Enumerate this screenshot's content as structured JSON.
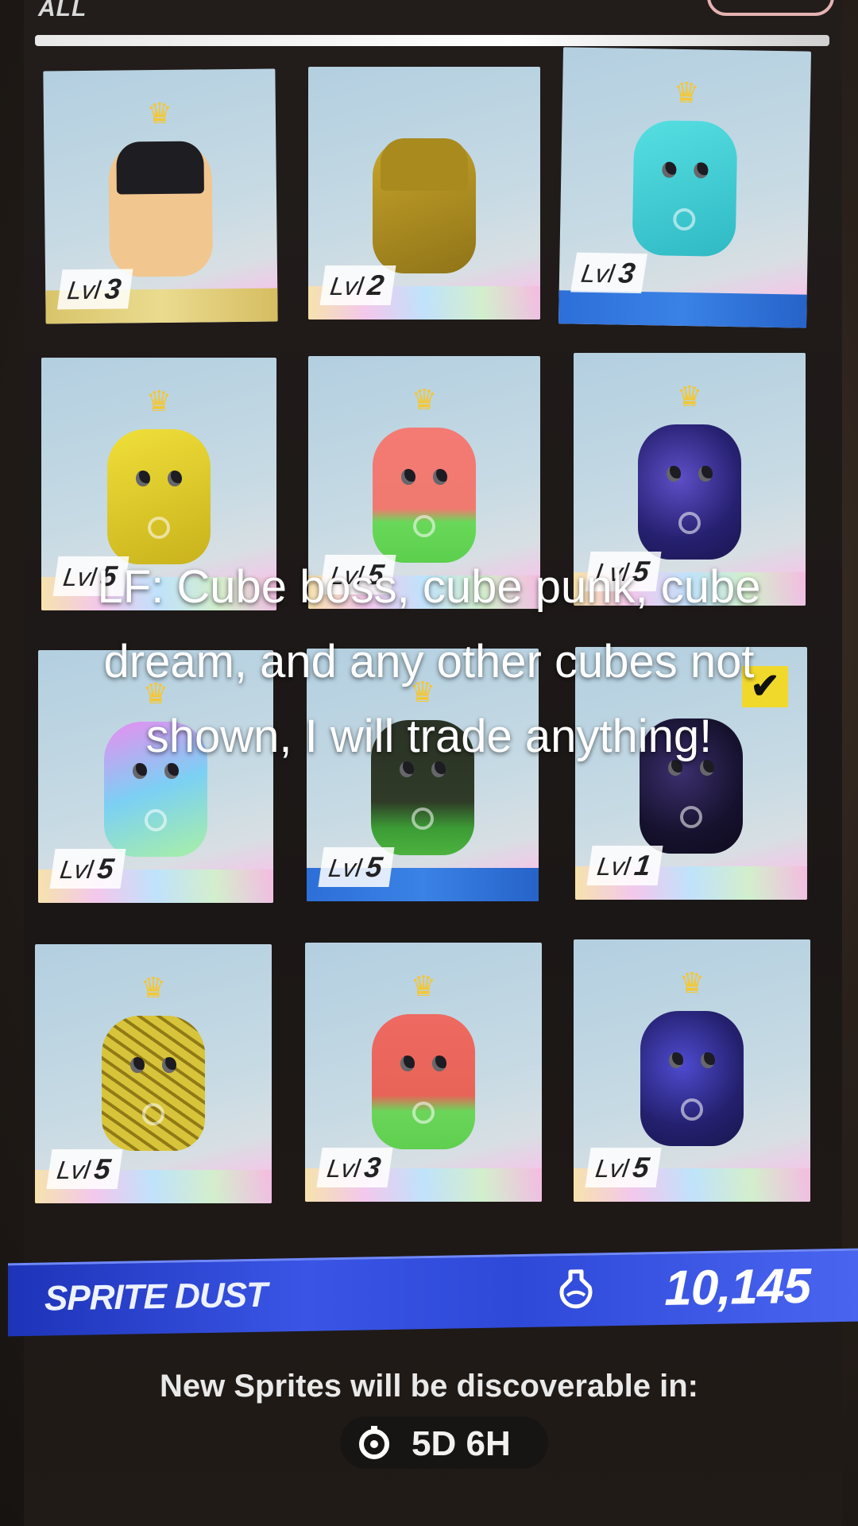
{
  "header": {
    "tab_label": "ALL"
  },
  "cards": [
    {
      "level_prefix": "Lvl",
      "level": "3",
      "sprite": "batman-cube-sprite"
    },
    {
      "level_prefix": "Lvl",
      "level": "2",
      "sprite": "gold-batman-cube-sprite"
    },
    {
      "level_prefix": "Lvl",
      "level": "3",
      "sprite": "teal-sprite"
    },
    {
      "level_prefix": "Lvl",
      "level": "5",
      "sprite": "yellow-sprite"
    },
    {
      "level_prefix": "Lvl",
      "level": "5",
      "sprite": "watermelon-sprite"
    },
    {
      "level_prefix": "Lvl",
      "level": "5",
      "sprite": "galaxy-sprite"
    },
    {
      "level_prefix": "Lvl",
      "level": "5",
      "sprite": "holographic-sprite"
    },
    {
      "level_prefix": "Lvl",
      "level": "5",
      "sprite": "dark-green-sprite"
    },
    {
      "level_prefix": "Lvl",
      "level": "1",
      "sprite": "dark-galaxy-sprite",
      "selected": true
    },
    {
      "level_prefix": "Lvl",
      "level": "5",
      "sprite": "gold-skull-sprite"
    },
    {
      "level_prefix": "Lvl",
      "level": "3",
      "sprite": "watermelon-skull-sprite"
    },
    {
      "level_prefix": "Lvl",
      "level": "5",
      "sprite": "galaxy-skull-sprite"
    }
  ],
  "currency": {
    "label": "SPRITE DUST",
    "value": "10,145",
    "icon": "potion-icon"
  },
  "discovery": {
    "text": "New Sprites will be discoverable in:",
    "timer": "5D 6H",
    "icon": "timer-icon"
  },
  "caption": "LF: Cube boss, cube punk, cube dream, and any other cubes not shown, I will trade anything!",
  "colors": {
    "accent_blue": "#2e49d8",
    "crown": "#f3c735",
    "check": "#f1d92c"
  }
}
